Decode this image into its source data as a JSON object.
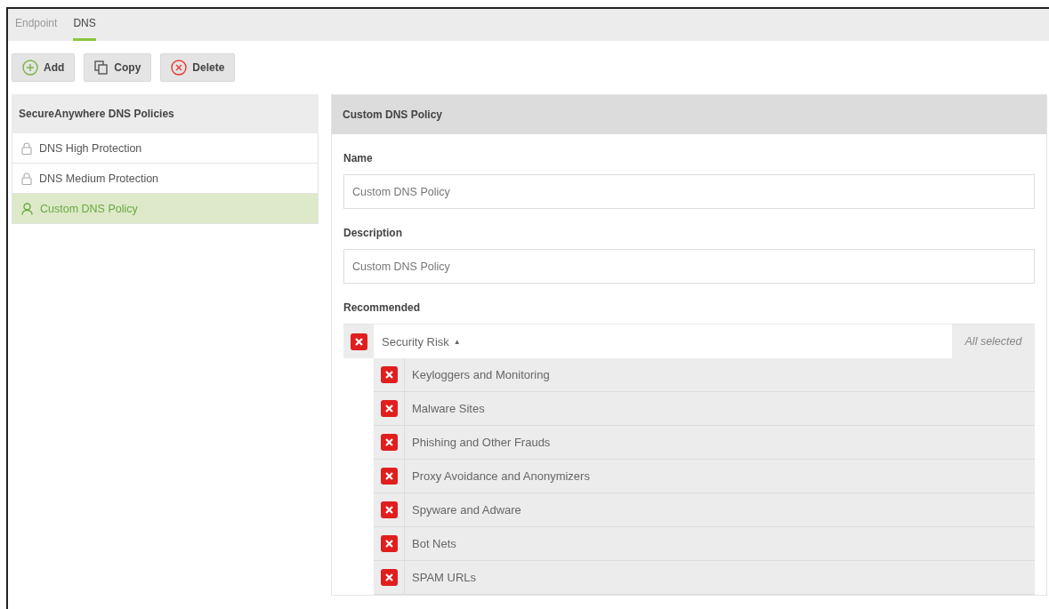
{
  "tabs": [
    {
      "label": "Endpoint",
      "selected": false
    },
    {
      "label": "DNS",
      "selected": true
    }
  ],
  "toolbar": [
    {
      "kind": "add",
      "label": "Add"
    },
    {
      "kind": "copy",
      "label": "Copy"
    },
    {
      "kind": "delete",
      "label": "Delete"
    }
  ],
  "policies": {
    "title": "SecureAnywhere DNS Policies",
    "items": [
      {
        "kind": "locked",
        "label": "DNS High Protection",
        "selected": false
      },
      {
        "kind": "locked",
        "label": "DNS Medium Protection",
        "selected": false
      },
      {
        "kind": "custom",
        "label": "Custom DNS Policy",
        "selected": true
      }
    ]
  },
  "editor": {
    "title": "Custom DNS Policy",
    "name": {
      "label": "Name",
      "value": "Custom DNS Policy"
    },
    "description": {
      "label": "Description",
      "value": "Custom DNS Policy"
    },
    "recommended": {
      "label": "Recommended",
      "group": {
        "label": "Security Risk",
        "caret": "▲",
        "expanded": true,
        "blocked": true,
        "summary": "All selected",
        "items": [
          {
            "label": "Keyloggers and Monitoring",
            "blocked": true
          },
          {
            "label": "Malware Sites",
            "blocked": true
          },
          {
            "label": "Phishing and Other Frauds",
            "blocked": true
          },
          {
            "label": "Proxy Avoidance and Anonymizers",
            "blocked": true
          },
          {
            "label": "Spyware and Adware",
            "blocked": true
          },
          {
            "label": "Bot Nets",
            "blocked": true
          },
          {
            "label": "SPAM URLs",
            "blocked": true
          }
        ]
      }
    }
  }
}
